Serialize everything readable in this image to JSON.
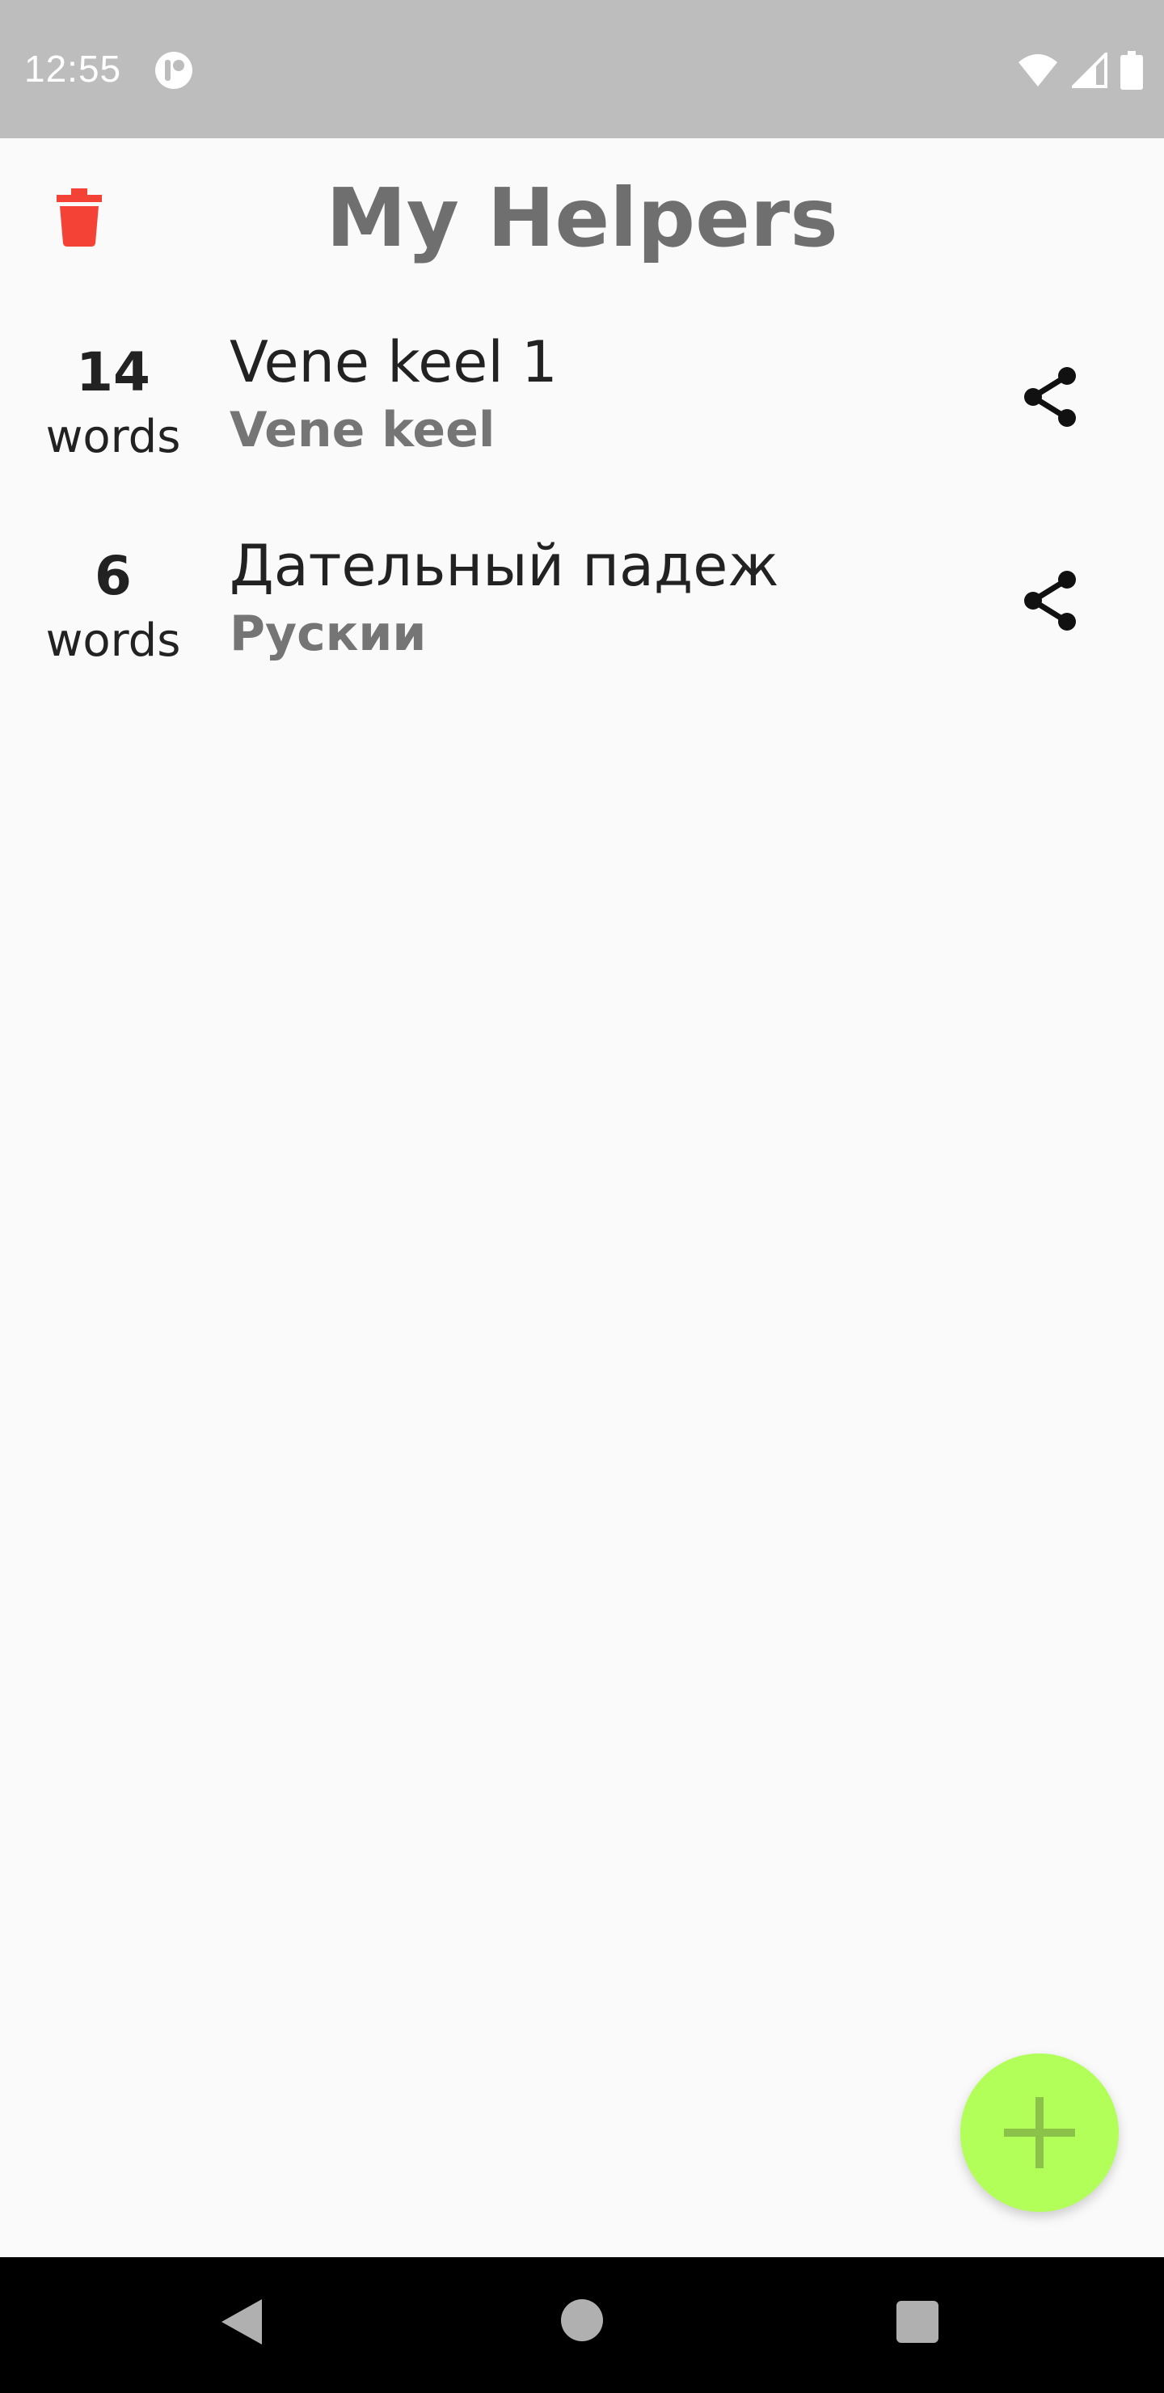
{
  "status_bar": {
    "time": "12:55",
    "app_icon": "notification-app-icon",
    "icons": [
      "wifi-icon",
      "cell-signal-icon",
      "battery-icon"
    ]
  },
  "header": {
    "title": "My Helpers",
    "delete_icon": "trash-icon",
    "delete_color": "#f44336"
  },
  "helpers": [
    {
      "count": "14",
      "unit": "words",
      "name": "Vene keel 1",
      "language": "Vene keel"
    },
    {
      "count": "6",
      "unit": "words",
      "name": "Дательный падеж",
      "language": "Рускии"
    }
  ],
  "fab": {
    "icon": "plus-icon",
    "color": "#b2ff59"
  },
  "nav_bar": {
    "icons": [
      "back-icon",
      "home-icon",
      "recents-icon"
    ]
  }
}
